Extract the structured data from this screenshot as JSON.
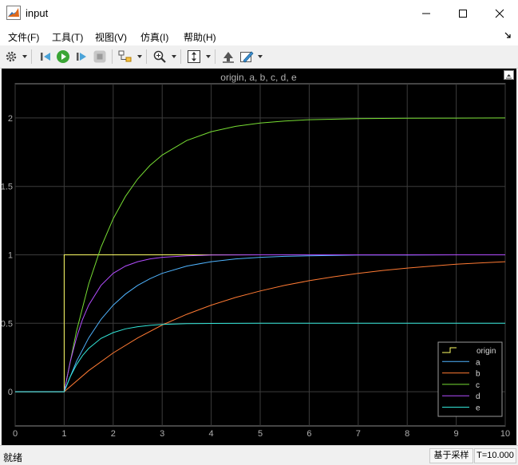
{
  "window": {
    "title": "input"
  },
  "menu": {
    "items": [
      "文件(F)",
      "工具(T)",
      "视图(V)",
      "仿真(I)",
      "帮助(H)"
    ]
  },
  "toolbar": {
    "icons": [
      "gear-icon",
      "step-back-icon",
      "run-icon",
      "step-forward-icon",
      "stop-icon",
      "highlight-icon",
      "zoom-icon",
      "autoscale-icon",
      "restore-icon",
      "style-icon"
    ]
  },
  "scope": {
    "title": "origin, a, b, c, d, e"
  },
  "chart_data": {
    "type": "line",
    "title": "origin, a, b, c, d, e",
    "xlabel": "",
    "ylabel": "",
    "xlim": [
      0,
      10
    ],
    "ylim": [
      -0.25,
      2.25
    ],
    "xticks": [
      "0",
      "1",
      "2",
      "3",
      "4",
      "5",
      "6",
      "7",
      "8",
      "9",
      "10"
    ],
    "yticks": [
      "0",
      "0.5",
      "1",
      "1.5",
      "2"
    ],
    "grid": true,
    "legend_position": "bottom-right",
    "background": "#000000",
    "series": [
      {
        "name": "origin",
        "color": "#ffff66",
        "x": [
          0,
          1,
          1,
          10
        ],
        "y": [
          0,
          0,
          1,
          1
        ]
      },
      {
        "name": "a",
        "color": "#4fb4ff",
        "x": [
          0,
          1,
          1.25,
          1.5,
          1.75,
          2,
          2.25,
          2.5,
          2.75,
          3,
          3.5,
          4,
          4.5,
          5,
          5.5,
          6,
          7,
          8,
          9,
          10
        ],
        "y": [
          0,
          0,
          0.221,
          0.393,
          0.528,
          0.632,
          0.713,
          0.777,
          0.826,
          0.865,
          0.918,
          0.95,
          0.97,
          0.982,
          0.989,
          0.993,
          0.998,
          0.999,
          1.0,
          1.0
        ]
      },
      {
        "name": "b",
        "color": "#ff7a33",
        "x": [
          0,
          1,
          1.5,
          2,
          2.5,
          3,
          3.5,
          4,
          4.5,
          5,
          5.5,
          6,
          6.5,
          7,
          7.5,
          8,
          8.5,
          9,
          9.5,
          10
        ],
        "y": [
          0,
          0,
          0.154,
          0.283,
          0.393,
          0.487,
          0.565,
          0.632,
          0.689,
          0.736,
          0.777,
          0.811,
          0.84,
          0.865,
          0.886,
          0.903,
          0.918,
          0.931,
          0.941,
          0.95
        ]
      },
      {
        "name": "c",
        "color": "#77dd33",
        "x": [
          0,
          1,
          1.25,
          1.5,
          1.75,
          2,
          2.25,
          2.5,
          2.75,
          3,
          3.5,
          4,
          4.5,
          5,
          5.5,
          6,
          7,
          8,
          9,
          10
        ],
        "y": [
          0,
          0,
          0.442,
          0.787,
          1.055,
          1.264,
          1.427,
          1.554,
          1.653,
          1.729,
          1.835,
          1.9,
          1.939,
          1.963,
          1.978,
          1.987,
          1.995,
          1.998,
          1.999,
          2.0
        ]
      },
      {
        "name": "d",
        "color": "#b34dff",
        "x": [
          0,
          1,
          1.125,
          1.25,
          1.375,
          1.5,
          1.75,
          2,
          2.25,
          2.5,
          2.75,
          3,
          3.5,
          4,
          5,
          10
        ],
        "y": [
          0,
          0,
          0.221,
          0.393,
          0.528,
          0.632,
          0.777,
          0.865,
          0.918,
          0.95,
          0.97,
          0.982,
          0.993,
          0.998,
          1.0,
          1.0
        ]
      },
      {
        "name": "e",
        "color": "#33e6d9",
        "x": [
          0,
          1,
          1.125,
          1.25,
          1.375,
          1.5,
          1.75,
          2,
          2.25,
          2.5,
          2.75,
          3,
          3.5,
          4,
          5,
          10
        ],
        "y": [
          0,
          0,
          0.111,
          0.197,
          0.264,
          0.316,
          0.389,
          0.432,
          0.459,
          0.475,
          0.485,
          0.491,
          0.497,
          0.499,
          0.5,
          0.5
        ]
      }
    ]
  },
  "status": {
    "left": "就绪",
    "mode": "基于采样",
    "time": "T=10.000"
  }
}
